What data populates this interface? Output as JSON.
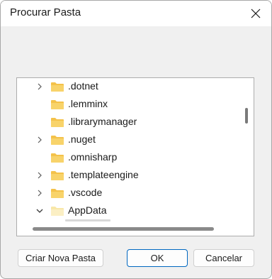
{
  "dialog": {
    "title": "Procurar Pasta",
    "close_icon": "close-icon"
  },
  "tree": {
    "items": [
      {
        "label": ".dotnet",
        "expand": "collapsed"
      },
      {
        "label": ".lemminx",
        "expand": "none"
      },
      {
        "label": ".librarymanager",
        "expand": "none"
      },
      {
        "label": ".nuget",
        "expand": "collapsed"
      },
      {
        "label": ".omnisharp",
        "expand": "none"
      },
      {
        "label": ".templateengine",
        "expand": "collapsed"
      },
      {
        "label": ".vscode",
        "expand": "collapsed"
      },
      {
        "label": "AppData",
        "expand": "expanded"
      }
    ]
  },
  "buttons": {
    "new_folder": "Criar Nova Pasta",
    "ok": "OK",
    "cancel": "Cancelar"
  },
  "colors": {
    "folder": "#f4c24a",
    "folder_light": "#f8e7a8",
    "accent": "#0067c0"
  }
}
